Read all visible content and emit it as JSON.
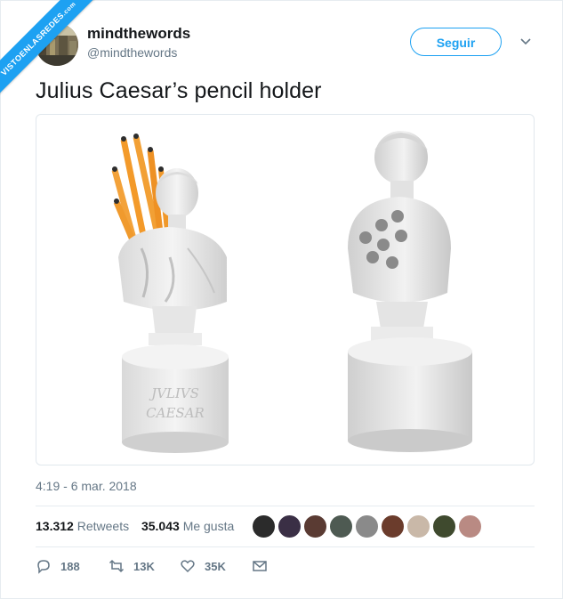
{
  "watermark": {
    "main": "VISTOENLASREDES",
    "suffix": ".com"
  },
  "author": {
    "display_name": "mindthewords",
    "handle": "@mindthewords",
    "avatar_icon": "avatar-photo"
  },
  "follow_button": {
    "label": "Seguir"
  },
  "tweet": {
    "text": "Julius Caesar’s pencil holder",
    "timestamp": "4:19 - 6 mar. 2018"
  },
  "media": {
    "pedestal_text_line1": "JVLIVS",
    "pedestal_text_line2": "CAESAR"
  },
  "stats": {
    "retweets_count": "13.312",
    "retweets_label": "Retweets",
    "likes_count": "35.043",
    "likes_label": "Me gusta"
  },
  "likers": [
    {
      "color": "#2b2b2b"
    },
    {
      "color": "#3a2f45"
    },
    {
      "color": "#5a3b33"
    },
    {
      "color": "#4e5a52"
    },
    {
      "color": "#8a8a8a"
    },
    {
      "color": "#6b3c2c"
    },
    {
      "color": "#c9b8a8"
    },
    {
      "color": "#3f4a2e"
    },
    {
      "color": "#b98a83"
    }
  ],
  "actions": {
    "reply_count": "188",
    "retweet_count": "13K",
    "like_count": "35K"
  },
  "colors": {
    "accent": "#1da1f2",
    "secondary_text": "#657786",
    "border": "#e6ecf0"
  }
}
